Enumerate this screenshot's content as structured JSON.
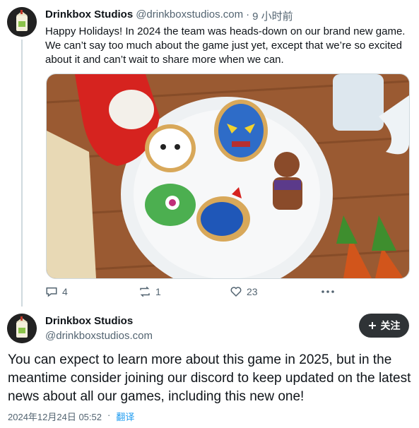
{
  "tweet1": {
    "author_name": "Drinkbox Studios",
    "handle": "@drinkboxstudios.com",
    "separator": "·",
    "time": "9 小时前",
    "text": "Happy Holidays! In 2024 the team was heads-down on our brand new game. We can’t say too much about the game just yet, except that we’re so excited about it and can’t wait to share more when we can.",
    "actions": {
      "replies": "4",
      "reposts": "1",
      "likes": "23"
    }
  },
  "tweet2": {
    "author_name": "Drinkbox Studios",
    "handle": "@drinkboxstudios.com",
    "follow_label": "关注",
    "text": "You can expect to learn more about this game in 2025, but in the meantime consider joining our discord to keep updated on the latest news about all our games, including this new one!",
    "timestamp": "2024年12月24日 05:52",
    "dot": "·",
    "translate_label": "翻译"
  },
  "icons": [
    "avatar-milk-icon",
    "reply-icon",
    "repost-icon",
    "like-icon",
    "more-icon",
    "plus-icon"
  ]
}
